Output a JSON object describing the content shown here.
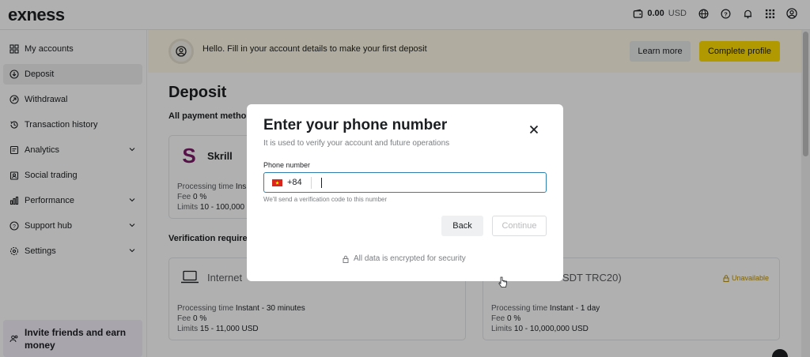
{
  "app": {
    "logo_text": "exness"
  },
  "topbar": {
    "balance_amount": "0.00",
    "balance_currency": "USD"
  },
  "sidebar": {
    "items": [
      {
        "label": "My accounts",
        "icon": "grid-icon"
      },
      {
        "label": "Deposit",
        "icon": "deposit-icon",
        "active": true
      },
      {
        "label": "Withdrawal",
        "icon": "withdrawal-icon"
      },
      {
        "label": "Transaction history",
        "icon": "history-icon"
      },
      {
        "label": "Analytics",
        "icon": "analytics-icon",
        "expandable": true
      },
      {
        "label": "Social trading",
        "icon": "social-trading-icon"
      },
      {
        "label": "Performance",
        "icon": "performance-icon",
        "expandable": true
      },
      {
        "label": "Support hub",
        "icon": "help-icon",
        "expandable": true
      },
      {
        "label": "Settings",
        "icon": "settings-icon",
        "expandable": true
      }
    ],
    "invite": {
      "line1": "Invite friends and earn",
      "line2": "money"
    }
  },
  "banner": {
    "text": "Hello. Fill in your account details to make your first deposit",
    "learn_more": "Learn more",
    "complete_profile": "Complete profile"
  },
  "main": {
    "title": "Deposit",
    "all_methods_label": "All payment metho",
    "verification_label": "Verification required",
    "skrill": {
      "name": "Skrill",
      "processing": "Processing time",
      "processing_value": "Ins",
      "fee": "Fee",
      "fee_value": "0 %",
      "limits": "Limits",
      "limits_value": "10 - 100,000"
    },
    "internet_banking": {
      "name": "Internet",
      "processing": "Processing time",
      "processing_value": "Instant - 30 minutes",
      "fee": "Fee",
      "fee_value": "0 %",
      "limits": "Limits",
      "limits_value": "15 - 11,000 USD"
    },
    "usdt": {
      "name": "SDT TRC20)",
      "status": "Unavailable",
      "processing": "Processing time",
      "processing_value": "Instant - 1 day",
      "fee": "Fee",
      "fee_value": "0 %",
      "limits": "Limits",
      "limits_value": "10 - 10,000,000 USD"
    }
  },
  "modal": {
    "title": "Enter your phone number",
    "subtitle": "It is used to verify your account and future operations",
    "field_label": "Phone number",
    "country_code": "+84",
    "phone_value": "",
    "hint": "We'll send a verification code to this number",
    "back": "Back",
    "continue": "Continue",
    "secure_note": "All data is encrypted for security"
  },
  "colors": {
    "brand_yellow": "#ffde02",
    "banner_bg": "#fff9e6",
    "focus_border": "#2f80b0",
    "unavailable": "#b7900c",
    "skrill_purple": "#7d1a6b"
  }
}
